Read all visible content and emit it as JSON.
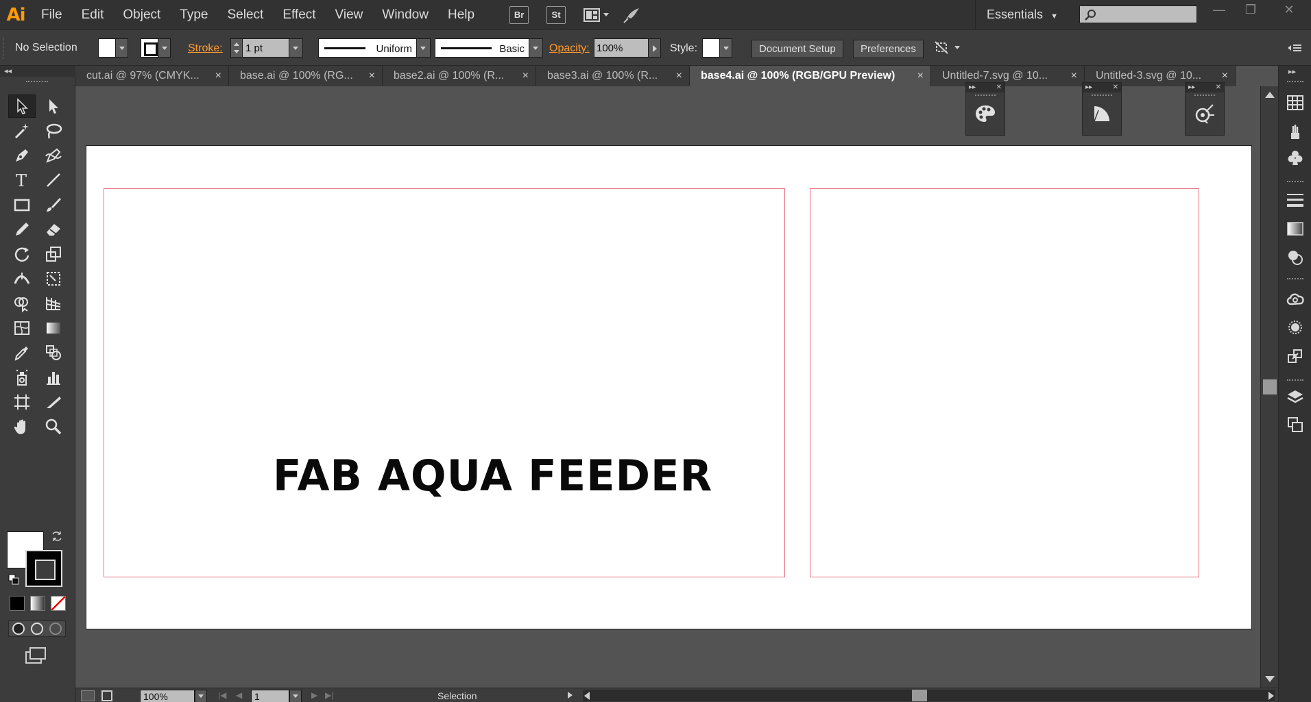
{
  "app": {
    "logo": "Ai"
  },
  "menu": [
    "File",
    "Edit",
    "Object",
    "Type",
    "Select",
    "Effect",
    "View",
    "Window",
    "Help"
  ],
  "app_buttons": [
    "Br",
    "St"
  ],
  "workspace": {
    "label": "Essentials",
    "search_placeholder": ""
  },
  "control_bar": {
    "selection": "No Selection",
    "stroke_label": "Stroke:",
    "stroke_weight": "1 pt",
    "profile": "Uniform",
    "brush": "Basic",
    "opacity_label": "Opacity:",
    "opacity_value": "100%",
    "style_label": "Style:",
    "document_setup": "Document Setup",
    "preferences": "Preferences"
  },
  "tabs": [
    {
      "label": "cut.ai @ 97% (CMYK...",
      "active": false
    },
    {
      "label": "base.ai @ 100% (RG...",
      "active": false
    },
    {
      "label": "base2.ai @ 100% (R...",
      "active": false
    },
    {
      "label": "base3.ai @ 100% (R...",
      "active": false
    },
    {
      "label": "base4.ai @ 100% (RGB/GPU Preview)",
      "active": true
    },
    {
      "label": "Untitled-7.svg @ 10...",
      "active": false
    },
    {
      "label": "Untitled-3.svg @ 10...",
      "active": false
    }
  ],
  "close_glyph": "×",
  "artwork": {
    "headline": "FAB AQUA FEEDER"
  },
  "status_bar": {
    "zoom": "100%",
    "page": "1",
    "current_tool": "Selection"
  },
  "colors": {
    "accent": "#ff9a00",
    "artboard_border": "#e56b7e",
    "link": "#ff9a2e"
  }
}
